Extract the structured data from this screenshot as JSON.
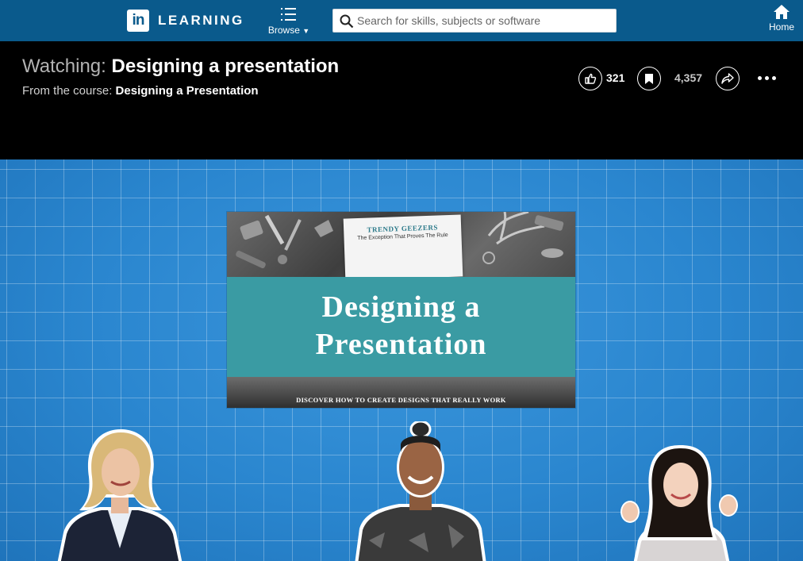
{
  "nav": {
    "logo_mark": "in",
    "logo_text": "LEARNING",
    "browse_label": "Browse",
    "search_placeholder": "Search for skills, subjects or software",
    "home_label": "Home"
  },
  "header": {
    "watching_prefix": "Watching:",
    "video_title": "Designing a presentation",
    "course_prefix": "From the course:",
    "course_title": "Designing a Presentation",
    "likes": "321",
    "saves": "4,357"
  },
  "video": {
    "brand": "TRENDY GEEZERS",
    "tagline": "The Exception That Proves The Rule",
    "title": "Designing a\nPresentation",
    "caption": "DISCOVER HOW TO CREATE DESIGNS THAT REALLY WORK"
  },
  "colors": {
    "nav_bg": "#0a5a8c",
    "video_bg": "#2a86cf",
    "teal": "#3a9ba3"
  },
  "icons": [
    "browse-grid-icon",
    "search-icon",
    "home-icon",
    "like-icon",
    "bookmark-icon",
    "share-icon",
    "more-icon"
  ]
}
